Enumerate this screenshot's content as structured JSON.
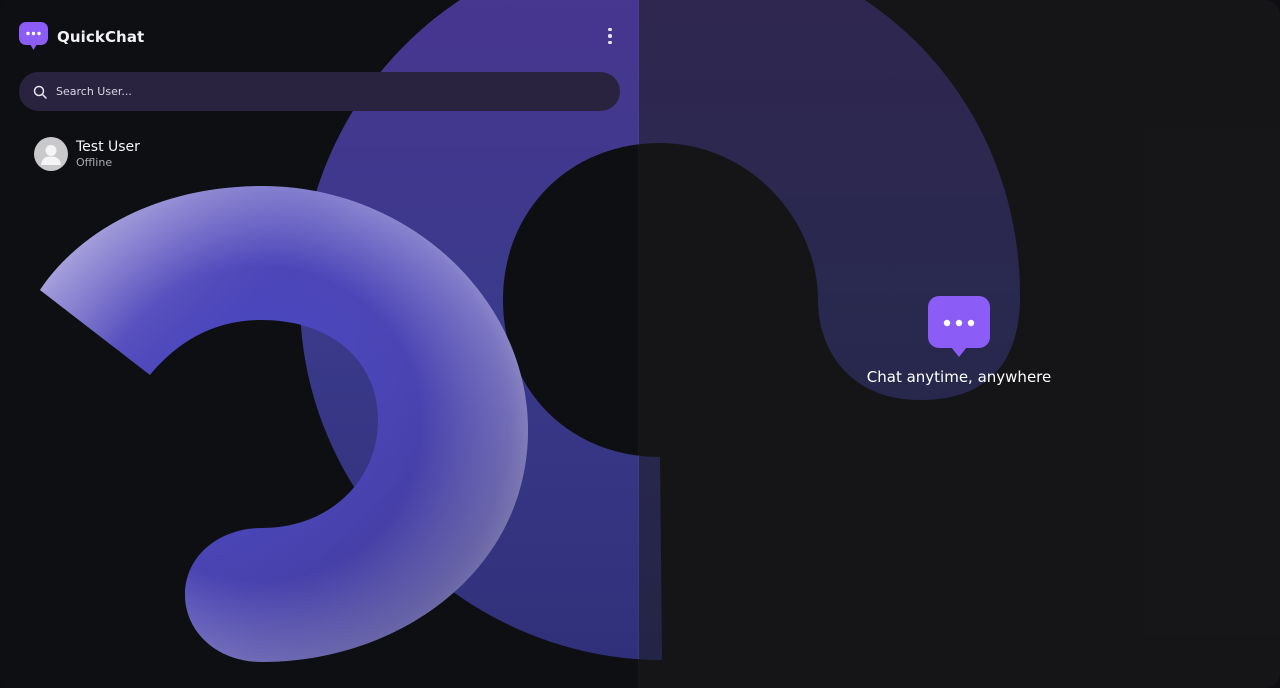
{
  "app": {
    "name": "QuickChat"
  },
  "search": {
    "placeholder": "Search User..."
  },
  "users": [
    {
      "name": "Test User",
      "status": "Offline"
    }
  ],
  "welcome": {
    "tagline": "Chat anytime, anywhere"
  },
  "icons": {
    "logo": "chat-bubble-icon",
    "menu": "kebab-menu-icon",
    "search": "search-icon",
    "avatar": "user-avatar-icon"
  },
  "colors": {
    "accent": "#8b5cf6",
    "background": "#0e0f13",
    "search_bg": "#2a2340"
  }
}
